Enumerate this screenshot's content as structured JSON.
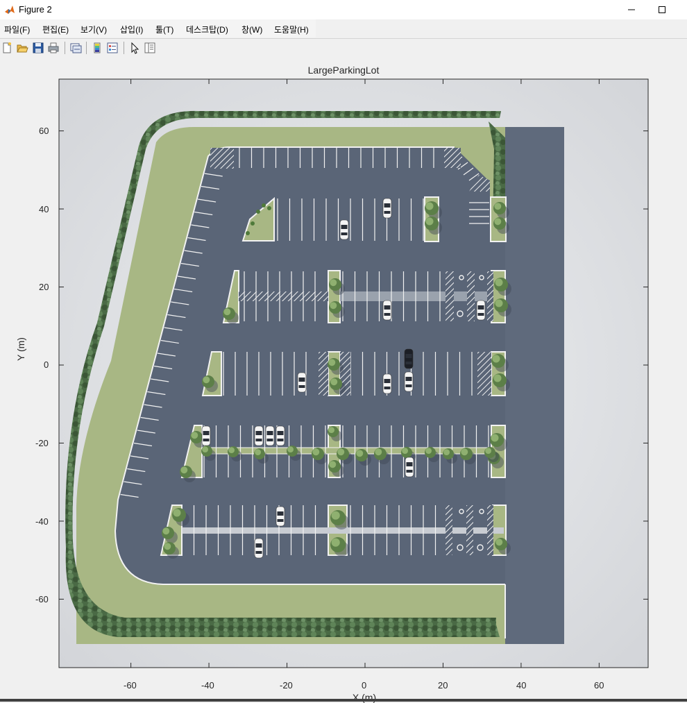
{
  "window": {
    "title": "Figure 2",
    "minimize_glyph": "—",
    "maximize_glyph": "☐"
  },
  "menu": {
    "items": [
      {
        "label": "파일(F)"
      },
      {
        "label": "편집(E)"
      },
      {
        "label": "보기(V)"
      },
      {
        "label": "삽입(I)"
      },
      {
        "label": "툴(T)"
      },
      {
        "label": "데스크탑(D)"
      },
      {
        "label": "창(W)"
      },
      {
        "label": "도움말(H)"
      }
    ]
  },
  "toolbar": {
    "icons": [
      "new-figure-icon",
      "open-file-icon",
      "save-icon",
      "print-icon",
      "link-plot-icon",
      "colorbar-icon",
      "legend-icon",
      "pointer-icon",
      "property-inspector-icon"
    ]
  },
  "axes": {
    "title": "LargeParkingLot",
    "xlabel": "X (m)",
    "ylabel": "Y (m)",
    "xlim": [
      -78,
      73
    ],
    "ylim": [
      -77,
      73
    ],
    "xticks": [
      "-60",
      "-40",
      "-20",
      "0",
      "20",
      "40",
      "60"
    ],
    "yticks": [
      "60",
      "40",
      "20",
      "0",
      "-20",
      "-40",
      "-60"
    ]
  },
  "scene": {
    "name": "LargeParkingLot",
    "colors": {
      "asphalt": "#5a6577",
      "grass": "#a8b784",
      "tree": "#3f5a3a",
      "background": "#d8d9dc",
      "marking": "#f2f2f2"
    }
  }
}
